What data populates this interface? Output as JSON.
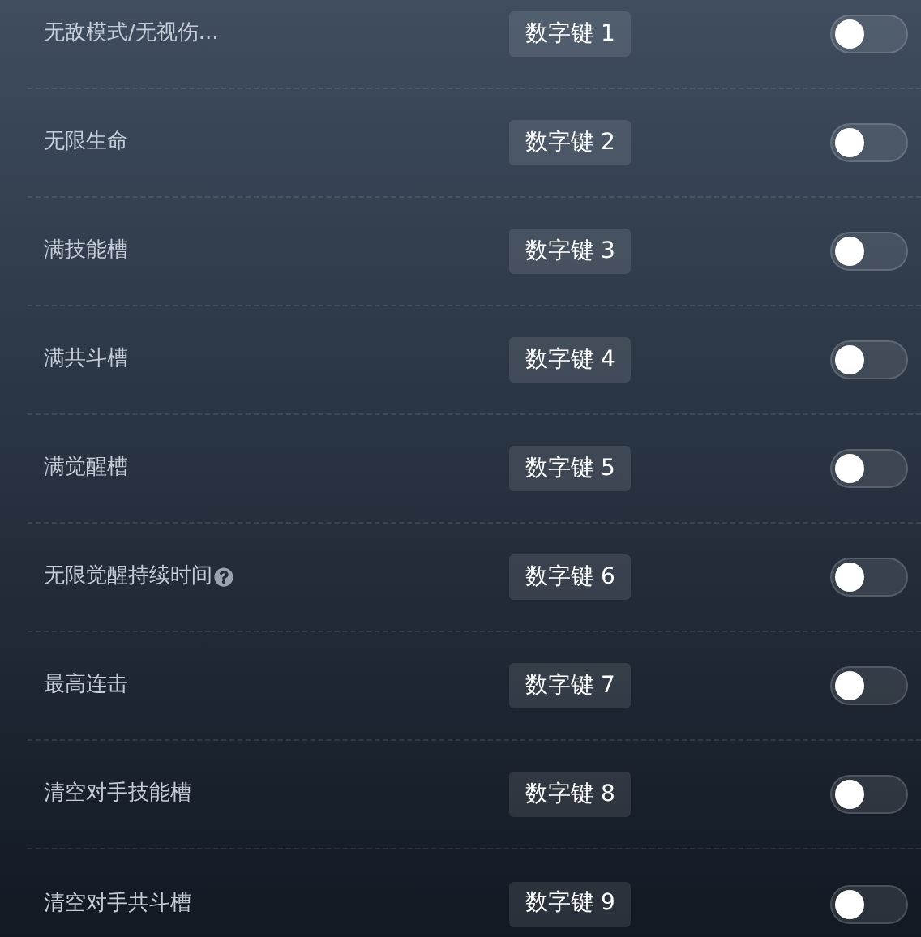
{
  "options": [
    {
      "label": "无敌模式/无视伤...",
      "hotkey": "数字键 1",
      "on": false,
      "help": false
    },
    {
      "label": "无限生命",
      "hotkey": "数字键 2",
      "on": false,
      "help": false
    },
    {
      "label": "满技能槽",
      "hotkey": "数字键 3",
      "on": false,
      "help": false
    },
    {
      "label": "满共斗槽",
      "hotkey": "数字键 4",
      "on": false,
      "help": false
    },
    {
      "label": "满觉醒槽",
      "hotkey": "数字键 5",
      "on": false,
      "help": false
    },
    {
      "label": "无限觉醒持续时间",
      "hotkey": "数字键 6",
      "on": false,
      "help": true
    },
    {
      "label": "最高连击",
      "hotkey": "数字键 7",
      "on": false,
      "help": false
    },
    {
      "label": "清空对手技能槽",
      "hotkey": "数字键 8",
      "on": false,
      "help": false
    },
    {
      "label": "清空对手共斗槽",
      "hotkey": "数字键 9",
      "on": false,
      "help": false
    }
  ]
}
